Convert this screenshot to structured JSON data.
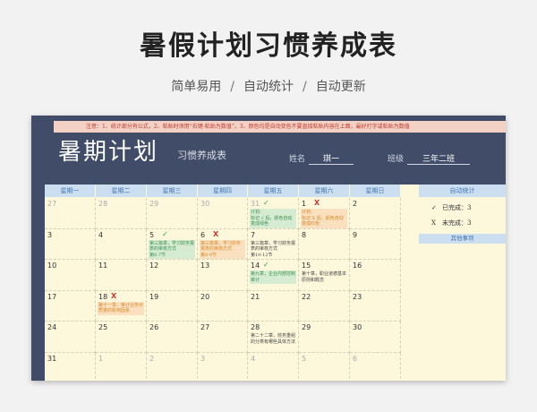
{
  "hero": {
    "title": "暑假计划习惯养成表",
    "tags": [
      "简单易用",
      "自动统计",
      "自动更新"
    ],
    "separator": "/"
  },
  "sheet": {
    "notice": "注意：1、统计部分有公式，2、粘贴时须用“右键-粘贴为数值”，3、颜色均是自动变色不要直接粘贴内容在上面，最好打字或粘贴为数值",
    "title": "暑期计划",
    "subtitle": "习惯养成表",
    "name_label": "姓名",
    "name_value": "琪一",
    "class_label": "班级",
    "class_value": "三年二班"
  },
  "calendar": {
    "weekdays": [
      "星期一",
      "星期二",
      "星期三",
      "星期四",
      "星期五",
      "星期六",
      "星期日"
    ],
    "weeks": [
      [
        {
          "day": "27",
          "other": true
        },
        {
          "day": "28",
          "other": true
        },
        {
          "day": "29",
          "other": true
        },
        {
          "day": "30",
          "other": true
        },
        {
          "day": "31",
          "other": true,
          "mark": "✓",
          "status": "done",
          "note": "计划:",
          "note2": "标记 √ 后，颜色自动变成绿色",
          "color": "green"
        },
        {
          "day": "1",
          "mark": "X",
          "status": "undone",
          "note": "计划:",
          "note2": "标记 X 后，颜色自动变成红色",
          "color": "orange"
        },
        {
          "day": "2"
        }
      ],
      [
        {
          "day": "3"
        },
        {
          "day": "4"
        },
        {
          "day": "5",
          "mark": "✓",
          "status": "done",
          "note": "第三篇章，学习财务报表的审核方式",
          "note2": "第6-7节",
          "color": "green"
        },
        {
          "day": "6",
          "mark": "X",
          "status": "undone",
          "note": "第三篇章，学习财务报表的审核方式",
          "note2": "第8-9节",
          "color": "orange"
        },
        {
          "day": "7",
          "note": "第三篇章，学习财务报表的审核方式",
          "note2": "第10-12节",
          "color": "plain"
        },
        {
          "day": "8"
        },
        {
          "day": "9"
        }
      ],
      [
        {
          "day": "10"
        },
        {
          "day": "11"
        },
        {
          "day": "12"
        },
        {
          "day": "13"
        },
        {
          "day": "14",
          "mark": "✓",
          "status": "done",
          "note": "第九章，企业内部控制审计",
          "color": "green"
        },
        {
          "day": "15",
          "note": "第十章，职业道德基本原则和概念",
          "color": "plain"
        },
        {
          "day": "16"
        }
      ],
      [
        {
          "day": "17"
        },
        {
          "day": "18",
          "mark": "X",
          "status": "undone",
          "note": "第十一章，审计业务对质量的影响因素",
          "color": "orange"
        },
        {
          "day": "19"
        },
        {
          "day": "20"
        },
        {
          "day": "21"
        },
        {
          "day": "22"
        },
        {
          "day": "23"
        }
      ],
      [
        {
          "day": "24"
        },
        {
          "day": "25"
        },
        {
          "day": "26"
        },
        {
          "day": "27"
        },
        {
          "day": "28",
          "note": "第二十二章，债务重组的分类有哪些具体方法",
          "color": "plain"
        },
        {
          "day": "29"
        },
        {
          "day": "30"
        }
      ],
      [
        {
          "day": "31"
        },
        {
          "day": "1",
          "other": true
        },
        {
          "day": "2",
          "other": true
        },
        {
          "day": "3",
          "other": true
        },
        {
          "day": "4",
          "other": true
        },
        {
          "day": "5",
          "other": true
        },
        {
          "day": "6",
          "other": true
        }
      ]
    ]
  },
  "stats": {
    "header": "自动统计",
    "done_icon": "✓",
    "done_label": "已完成：3",
    "undone_icon": "X",
    "undone_label": "未完成：3",
    "other_header": "其他事项"
  }
}
